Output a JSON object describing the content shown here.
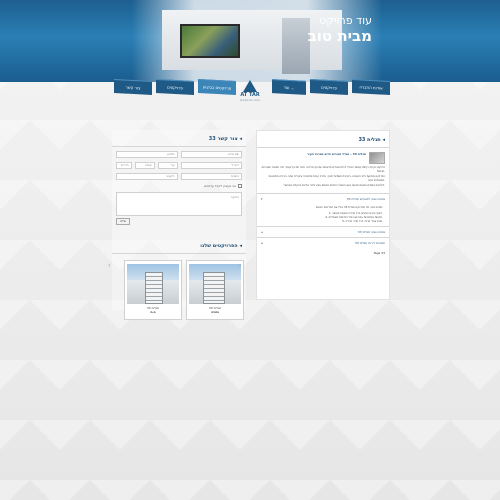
{
  "header": {
    "title_line1": "עוד פרויקט",
    "title_line2": "מבית טוב"
  },
  "nav": {
    "tabs": [
      {
        "label": "אודות החברה"
      },
      {
        "label": "פרויקטים"
      },
      {
        "label": "עוד ..."
      },
      {
        "label": "פרויקטים בביצוע"
      },
      {
        "label": "פרויקטים"
      },
      {
        "label": "צור קשר"
      }
    ]
  },
  "logo": {
    "name": "AT TAR",
    "sub": "בנייה ופרויקטים"
  },
  "right_panel": {
    "title": "תגלית 33",
    "article_title": "תגלית 33 - מגדל מגורים חדש במרכז העיר",
    "paragraphs": [
      "פרויקט יוקרתי בן 20 קומות הכולל דירות מגורים מרווחות עם נוף מרהיב, חניה תת קרקעית, לובי מפואר ומערכות חכמות.",
      "הפרויקט ממוקם בלב השכונה, בקרבת מוסדות חינוך, מרכזי קניות ותחבורה ציבורית נוחה. הבנייה מתבצעת בסטנדרט גבוה.",
      "לפרטים נוספים ותיאום פגישה אנא השאירו פרטים בטופס ונציג יחזור אליכם בהקדם האפשרי."
    ],
    "accordion_open_title": "מפרט טכני למגורים תגלית 33",
    "accordion_open_body": "מפרט טכני של הפרויקט תגלית 33 כולל את הפריטים הבאים:",
    "accordion_list": [
      "1. ריצוף גרניט פורצלן בכל הדירה ומטבח מעוצב.",
      "2. חלונות אלומיניום עם זיגוג כפול ותריסים חשמליים.",
      "3. מיזוג אוויר מרכזי בכל חדרי הדירה."
    ],
    "accordion_items": [
      {
        "label": "מפרט טכני תגלית 33"
      },
      {
        "label": "תוכניות דירות תגלית 33"
      }
    ],
    "tags_label": "Tags 33"
  },
  "left_panel": {
    "contact_title": "צור קשר 33",
    "fields": {
      "name": "שם מלא",
      "phone": "טלפון",
      "email": "דוא\"ל",
      "city": "עיר",
      "floor": "קומה",
      "rooms": "חדרים",
      "budget": "תקציב",
      "message": "הודעה",
      "address": "כתובת"
    },
    "checkbox_label": "אני מעוניין לקבל עדכונים",
    "send_label": "שלח",
    "projects_title": "הפרויקטים שלנו",
    "projects": [
      {
        "name": "תגלית 33",
        "city": "נתניה"
      },
      {
        "name": "תגלית 33",
        "city": "ב-ת"
      }
    ]
  }
}
